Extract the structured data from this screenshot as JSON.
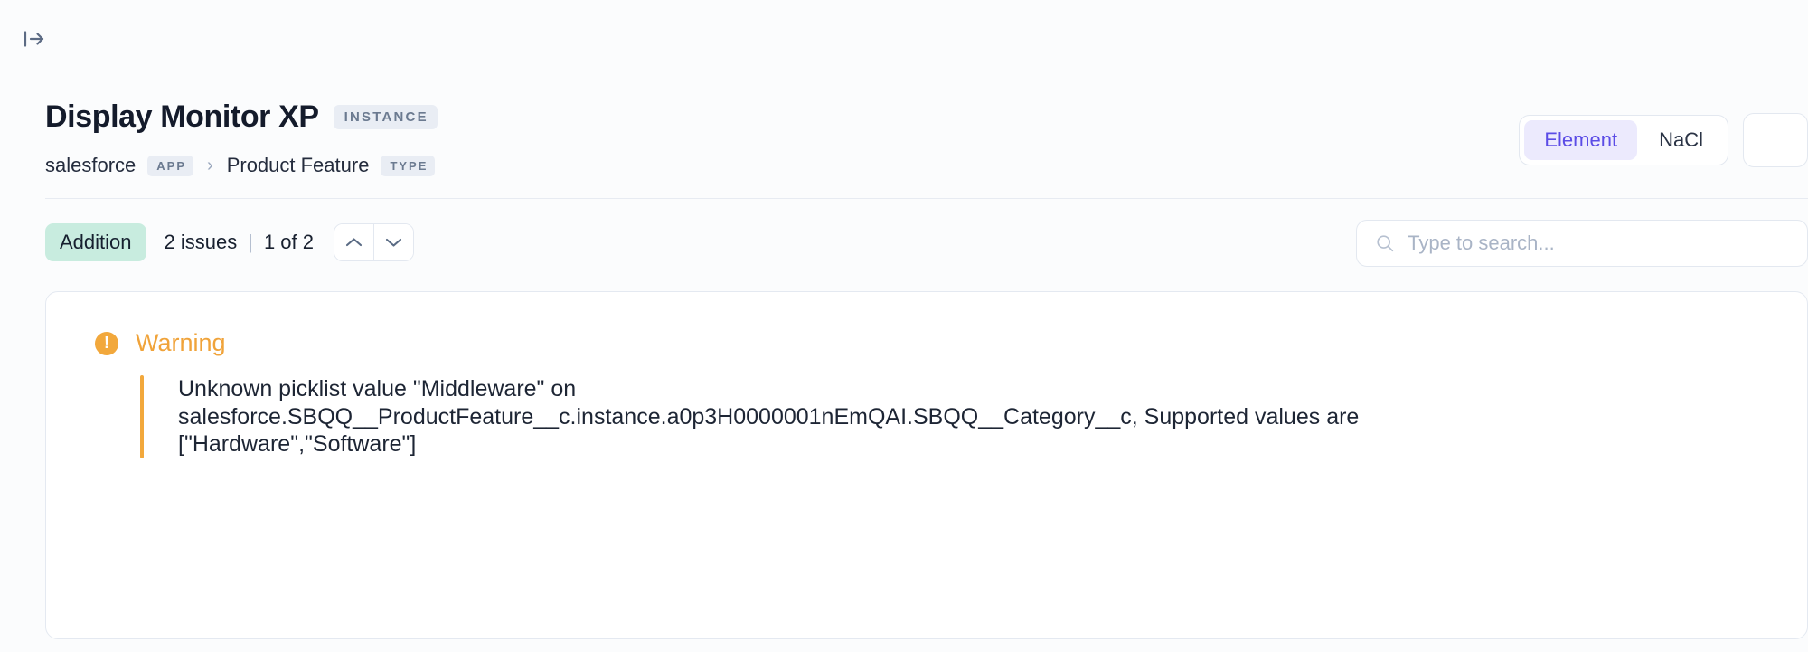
{
  "top_bar": {
    "panel_toggle_icon": "panel-expand-icon"
  },
  "header": {
    "title": "Display Monitor XP",
    "title_chip": "INSTANCE",
    "breadcrumb": {
      "app_name": "salesforce",
      "app_chip": "APP",
      "separator": "›",
      "type_name": "Product Feature",
      "type_chip": "TYPE"
    },
    "view_toggle": {
      "options": [
        "Element",
        "NaCl"
      ],
      "selected": "Element"
    }
  },
  "toolbar": {
    "change_badge": "Addition",
    "issue_count": "2 issues",
    "separator": "|",
    "pager": "1 of 2",
    "prev_icon": "chevron-up-icon",
    "next_icon": "chevron-down-icon",
    "search": {
      "icon": "search-icon",
      "value": "",
      "placeholder": "Type to search..."
    }
  },
  "issue_card": {
    "severity_icon": "warning-exclamation-icon",
    "severity_label": "Warning",
    "message": "Unknown picklist value \"Middleware\" on salesforce.SBQQ__ProductFeature__c.instance.a0p3H0000001nEmQAI.SBQQ__Category__c, Supported values are [\"Hardware\",\"Software\"]"
  },
  "colors": {
    "page_background": "#fbfcfd",
    "accent_purple": "#5b4ce6",
    "accent_purple_bg": "#eceafd",
    "addition_badge_bg": "#c8ecdf",
    "warning_orange": "#f0a33a",
    "chip_bg": "#e9edf4",
    "chip_text": "#6b7a90",
    "border": "#e3e8f0",
    "text_primary": "#1a2233",
    "placeholder": "#a9b4c6"
  }
}
